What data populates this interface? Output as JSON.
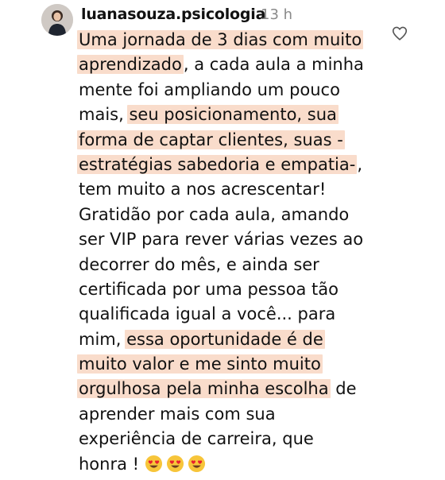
{
  "comment": {
    "username": "luanasouza.psicologia",
    "timestamp": "13 h",
    "avatar_icon": "profile-photo",
    "like_icon": "heart-outline-icon",
    "highlight_color": "#f9dccb",
    "lines": [
      {
        "highlight": "Uma jornada de 3 dias com muito",
        "rest": ""
      },
      {
        "highlight": "aprendizado",
        "rest": ", a cada aula a minha"
      },
      {
        "highlight": "",
        "rest": "mente foi ampliando um pouco"
      },
      {
        "highlight": "",
        "rest": "mais, ",
        "highlight2": "seu posicionamento, sua"
      },
      {
        "highlight": "forma de captar clientes, suas -",
        "rest": ""
      },
      {
        "highlight": "estratégias sabedoria e empatia-",
        "rest": ","
      },
      {
        "highlight": "",
        "rest": "tem muito a nos acrescentar!"
      },
      {
        "highlight": "",
        "rest": "Gratidão por cada aula, amando"
      },
      {
        "highlight": "",
        "rest": "ser VIP para rever várias vezes ao"
      },
      {
        "highlight": "",
        "rest": "decorrer do mês, e ainda ser"
      },
      {
        "highlight": "",
        "rest": "certificada por uma pessoa tão"
      },
      {
        "highlight": "",
        "rest": "qualificada igual a você... para"
      },
      {
        "highlight": "",
        "rest": "mim, ",
        "highlight2": "essa oportunidade é de"
      },
      {
        "highlight": "muito valor e me sinto muito",
        "rest": ""
      },
      {
        "highlight": "orgulhosa pela minha escolha",
        "rest": " de"
      },
      {
        "highlight": "",
        "rest": "aprender mais com sua"
      },
      {
        "highlight": "",
        "rest": "experiência de carreira, que"
      },
      {
        "highlight": "",
        "rest": "honra ! "
      }
    ],
    "emojis": [
      "heart-eyes-emoji",
      "heart-eyes-emoji",
      "heart-eyes-emoji"
    ]
  }
}
